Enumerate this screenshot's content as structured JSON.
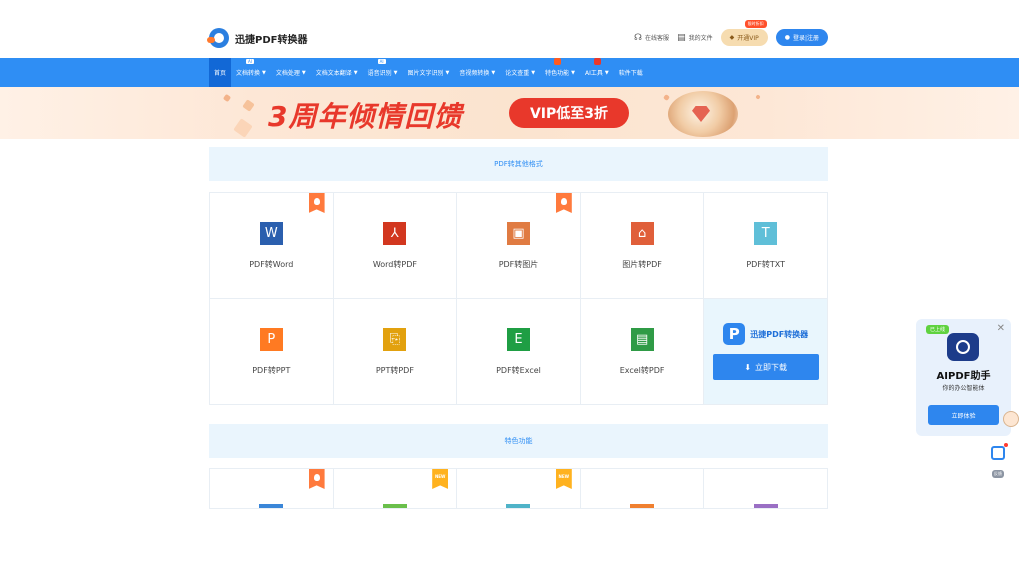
{
  "header": {
    "logo_text": "迅捷PDF转换器",
    "service": "在线客服",
    "my_files": "我的文件",
    "vip_tag": "限时折扣",
    "vip_btn": "开通VIP",
    "login": "登录|注册"
  },
  "nav": {
    "items": [
      {
        "label": "首页",
        "caret": false,
        "badge": ""
      },
      {
        "label": "文档转换",
        "caret": true,
        "badge": "AI"
      },
      {
        "label": "文档处理",
        "caret": true,
        "badge": ""
      },
      {
        "label": "文档文本翻译",
        "caret": true,
        "badge": ""
      },
      {
        "label": "语音识别",
        "caret": true,
        "badge": "AI"
      },
      {
        "label": "图片文字识别",
        "caret": true,
        "badge": ""
      },
      {
        "label": "音视频转换",
        "caret": true,
        "badge": ""
      },
      {
        "label": "论文查重",
        "caret": true,
        "badge": ""
      },
      {
        "label": "特色功能",
        "caret": true,
        "badge": "hot"
      },
      {
        "label": "AI工具",
        "caret": true,
        "badge": "hot-red"
      },
      {
        "label": "软件下载",
        "caret": false,
        "badge": ""
      }
    ]
  },
  "banner": {
    "title": "3周年倾情回馈",
    "pill": "VIP低至3折"
  },
  "section1": {
    "title": "PDF转其他格式",
    "tools": [
      {
        "label": "PDF转Word",
        "icon": "W",
        "color": "#2b5fae",
        "corner": "hot"
      },
      {
        "label": "Word转PDF",
        "icon": "⅄",
        "color": "#d2371f",
        "corner": ""
      },
      {
        "label": "PDF转图片",
        "icon": "▣",
        "color": "#e07b42",
        "corner": "hot"
      },
      {
        "label": "图片转PDF",
        "icon": "⌂",
        "color": "#e05f3a",
        "corner": ""
      },
      {
        "label": "PDF转TXT",
        "icon": "T",
        "color": "#5fbfd8",
        "corner": ""
      },
      {
        "label": "PDF转PPT",
        "icon": "P",
        "color": "#ff7a22",
        "corner": ""
      },
      {
        "label": "PPT转PDF",
        "icon": "⎘",
        "color": "#e2a10e",
        "corner": ""
      },
      {
        "label": "PDF转Excel",
        "icon": "E",
        "color": "#1f9e44",
        "corner": ""
      },
      {
        "label": "Excel转PDF",
        "icon": "▤",
        "color": "#2f9b46",
        "corner": ""
      }
    ],
    "promo": {
      "mark": "P",
      "name": "迅捷PDF转换器",
      "button": "立即下载"
    }
  },
  "section2": {
    "title": "特色功能",
    "tools": [
      {
        "corner": "hot",
        "color": "#3a86d8"
      },
      {
        "corner": "new",
        "color": "#6abf4b"
      },
      {
        "corner": "new",
        "color": "#4fb3c8"
      },
      {
        "corner": "",
        "color": "#f08030"
      },
      {
        "corner": "",
        "color": "#9a6fc4"
      }
    ],
    "new_label": "NEW"
  },
  "widget": {
    "tag": "已上线",
    "title": "AIPDF助手",
    "subtitle": "你的办公智能体",
    "button": "立即体验",
    "close": "✕"
  },
  "feedback": {
    "label": "反馈"
  }
}
